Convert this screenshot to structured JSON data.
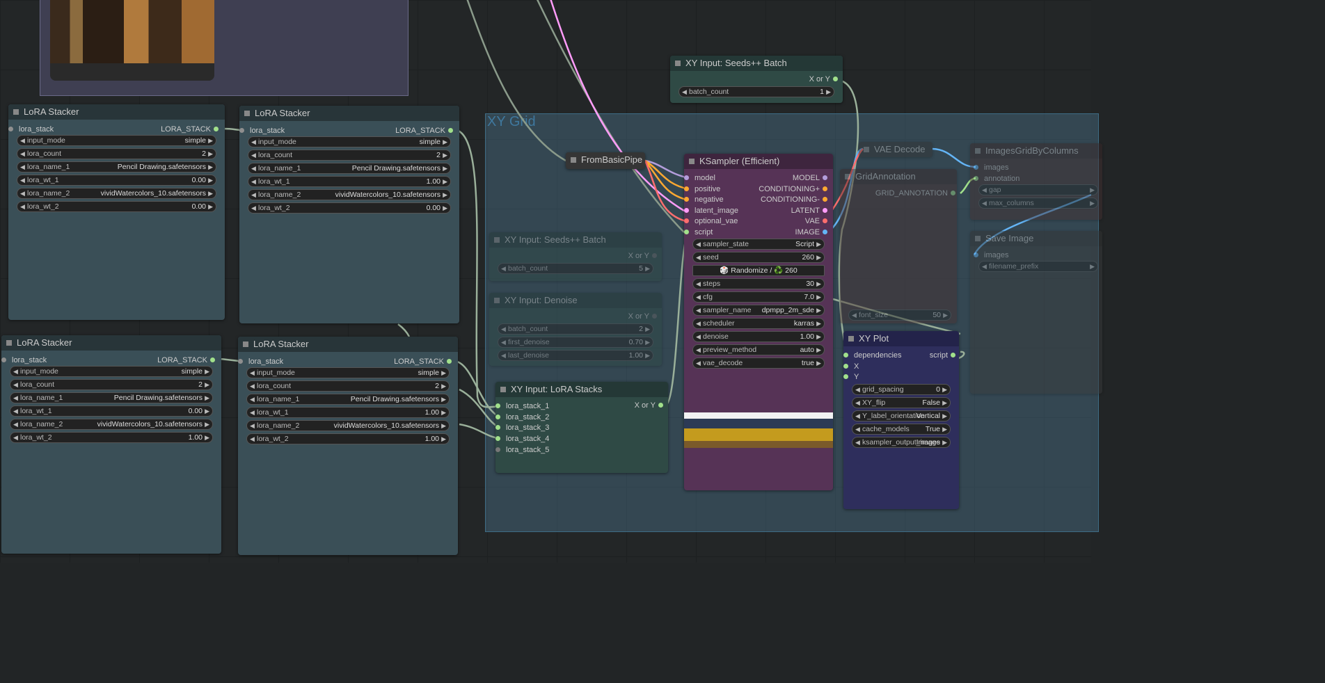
{
  "image_node_title": "",
  "group": {
    "title": "XY Grid"
  },
  "lora_stackers": [
    {
      "title": "LoRA Stacker",
      "input": "lora_stack",
      "output": "LORA_STACK",
      "widgets": [
        [
          "input_mode",
          "simple"
        ],
        [
          "lora_count",
          "2"
        ],
        [
          "lora_name_1",
          "Pencil Drawing.safetensors"
        ],
        [
          "lora_wt_1",
          "0.00"
        ],
        [
          "lora_name_2",
          "vividWatercolors_10.safetensors"
        ],
        [
          "lora_wt_2",
          "0.00"
        ]
      ]
    },
    {
      "title": "LoRA Stacker",
      "input": "lora_stack",
      "output": "LORA_STACK",
      "widgets": [
        [
          "input_mode",
          "simple"
        ],
        [
          "lora_count",
          "2"
        ],
        [
          "lora_name_1",
          "Pencil Drawing.safetensors"
        ],
        [
          "lora_wt_1",
          "1.00"
        ],
        [
          "lora_name_2",
          "vividWatercolors_10.safetensors"
        ],
        [
          "lora_wt_2",
          "0.00"
        ]
      ]
    },
    {
      "title": "LoRA Stacker",
      "input": "lora_stack",
      "output": "LORA_STACK",
      "widgets": [
        [
          "input_mode",
          "simple"
        ],
        [
          "lora_count",
          "2"
        ],
        [
          "lora_name_1",
          "Pencil Drawing.safetensors"
        ],
        [
          "lora_wt_1",
          "0.00"
        ],
        [
          "lora_name_2",
          "vividWatercolors_10.safetensors"
        ],
        [
          "lora_wt_2",
          "1.00"
        ]
      ]
    },
    {
      "title": "LoRA Stacker",
      "input": "lora_stack",
      "output": "LORA_STACK",
      "widgets": [
        [
          "input_mode",
          "simple"
        ],
        [
          "lora_count",
          "2"
        ],
        [
          "lora_name_1",
          "Pencil Drawing.safetensors"
        ],
        [
          "lora_wt_1",
          "1.00"
        ],
        [
          "lora_name_2",
          "vividWatercolors_10.safetensors"
        ],
        [
          "lora_wt_2",
          "1.00"
        ]
      ]
    }
  ],
  "seeds_batch_top": {
    "title": "XY Input: Seeds++ Batch",
    "output": "X or Y",
    "widgets": [
      [
        "batch_count",
        "1"
      ]
    ]
  },
  "seeds_batch_faded": {
    "title": "XY Input: Seeds++ Batch",
    "output": "X or Y",
    "widgets": [
      [
        "batch_count",
        "5"
      ]
    ]
  },
  "denoise": {
    "title": "XY Input: Denoise",
    "output": "X or Y",
    "widgets": [
      [
        "batch_count",
        "2"
      ],
      [
        "first_denoise",
        "0.70"
      ],
      [
        "last_denoise",
        "1.00"
      ]
    ]
  },
  "lora_stacks_input": {
    "title": "XY Input: LoRA Stacks",
    "output": "X or Y",
    "inputs": [
      "lora_stack_1",
      "lora_stack_2",
      "lora_stack_3",
      "lora_stack_4",
      "lora_stack_5"
    ]
  },
  "from_basic_pipe": {
    "title": "FromBasicPipe"
  },
  "ksampler": {
    "title": "KSampler (Efficient)",
    "inputs": [
      "model",
      "positive",
      "negative",
      "latent_image",
      "optional_vae",
      "script"
    ],
    "outputs": [
      "MODEL",
      "CONDITIONING+",
      "CONDITIONING-",
      "LATENT",
      "VAE",
      "IMAGE"
    ],
    "widgets": [
      [
        "sampler_state",
        "Script"
      ],
      [
        "seed",
        "260"
      ]
    ],
    "randomize_label": "🎲 Randomize / ♻️ 260",
    "widgets2": [
      [
        "steps",
        "30"
      ],
      [
        "cfg",
        "7.0"
      ],
      [
        "sampler_name",
        "dpmpp_2m_sde"
      ],
      [
        "scheduler",
        "karras"
      ],
      [
        "denoise",
        "1.00"
      ],
      [
        "preview_method",
        "auto"
      ],
      [
        "vae_decode",
        "true"
      ]
    ]
  },
  "vae_decode": {
    "title": "VAE Decode"
  },
  "grid_annotation": {
    "title": "GridAnnotation",
    "output": "GRID_ANNOTATION",
    "widgets": [
      [
        "font_size",
        "50"
      ]
    ]
  },
  "images_grid": {
    "title": "ImagesGridByColumns",
    "inputs": [
      "images",
      "annotation"
    ],
    "widgets": [
      [
        "gap",
        ""
      ],
      [
        "max_columns",
        ""
      ]
    ]
  },
  "save_image": {
    "title": "Save Image",
    "inputs": [
      "images"
    ],
    "widgets": [
      [
        "filename_prefix",
        ""
      ]
    ]
  },
  "xy_plot": {
    "title": "XY Plot",
    "inputs": [
      "dependencies",
      "X",
      "Y"
    ],
    "output": "script",
    "widgets": [
      [
        "grid_spacing",
        "0"
      ],
      [
        "XY_flip",
        "False"
      ],
      [
        "Y_label_orientation",
        "Vertical"
      ],
      [
        "cache_models",
        "True"
      ],
      [
        "ksampler_output_image",
        "Images"
      ]
    ]
  },
  "colors": {
    "model": "#b39ddb",
    "conditioning": "#ffa931",
    "latent": "#ff9cf9",
    "vae": "#ff6e6e",
    "image": "#64b5f6",
    "script": "#a1e08b",
    "generic": "#8f8f8f"
  }
}
